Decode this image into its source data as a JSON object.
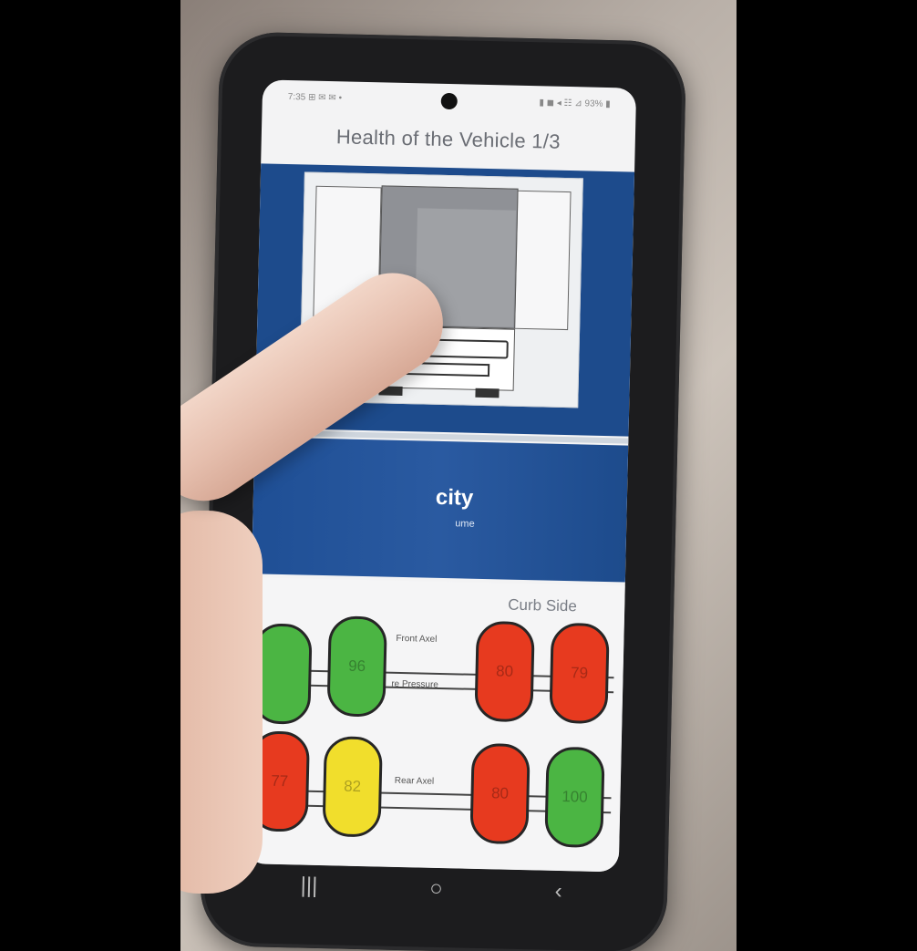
{
  "status_bar": {
    "left": "7:35 ⊞ ✉ ✉ •",
    "right": "▮ ◼ ◂ ☷ ⊿ 93% ▮"
  },
  "screen": {
    "title": "Health of the Vehicle 1/3"
  },
  "card": {
    "title": "city",
    "subtitle": "ume"
  },
  "tires": {
    "side_label": "Curb Side",
    "front_axle_label": "Front Axel",
    "pressure_label": "re Pressure",
    "rear_axle_label": "Rear Axel",
    "front_left_outer": "",
    "front_left_inner": "96",
    "front_right_inner": "80",
    "front_right_outer": "79",
    "rear_left_outer": "77",
    "rear_left_inner": "82",
    "rear_right_inner": "80",
    "rear_right_outer": "100"
  },
  "navbar": {
    "recents": "|||",
    "home": "○",
    "back": "‹"
  },
  "colors": {
    "ok": "#4bb543",
    "warn": "#f1de2c",
    "bad": "#e73a1f",
    "header": "#1d4b8c"
  }
}
